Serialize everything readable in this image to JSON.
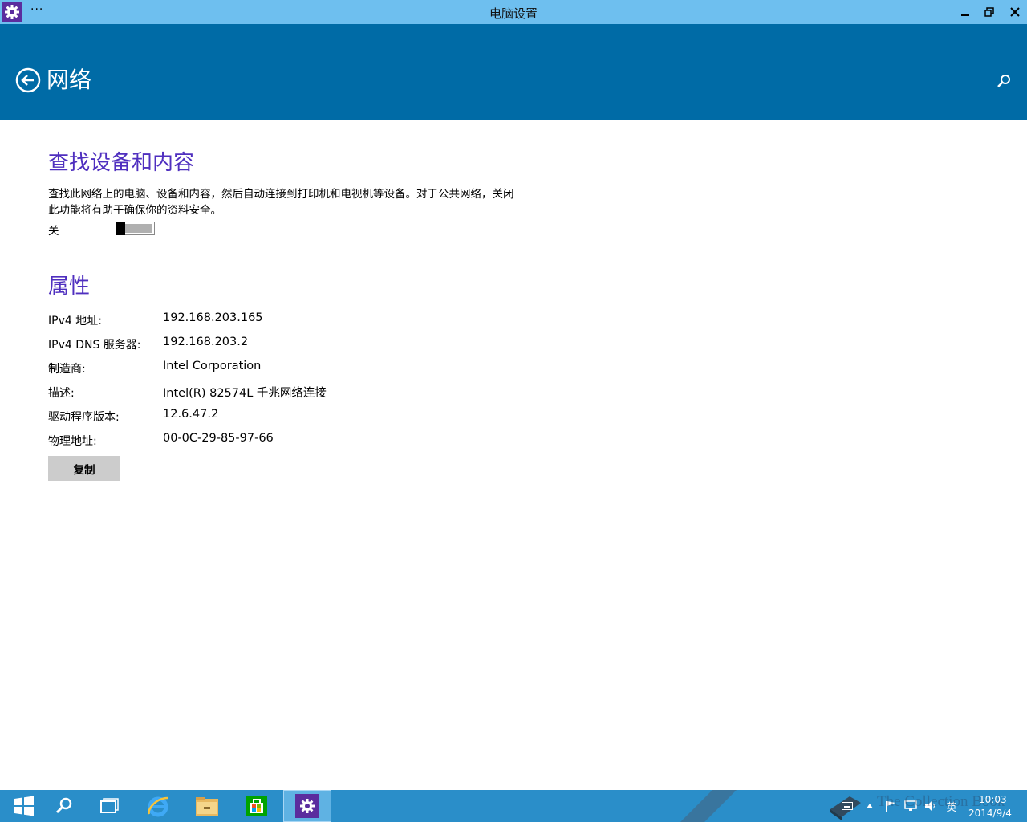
{
  "window": {
    "title": "电脑设置",
    "menu_dots": "···"
  },
  "header": {
    "title": "网络"
  },
  "find_devices": {
    "title": "查找设备和内容",
    "description": "查找此网络上的电脑、设备和内容，然后自动连接到打印机和电视机等设备。对于公共网络，关闭此功能将有助于确保你的资料安全。",
    "toggle_state": "关"
  },
  "properties": {
    "title": "属性",
    "rows": [
      {
        "label": "IPv4 地址:",
        "value": "192.168.203.165"
      },
      {
        "label": "IPv4 DNS 服务器:",
        "value": "192.168.203.2"
      },
      {
        "label": "制造商:",
        "value": "Intel Corporation"
      },
      {
        "label": "描述:",
        "value": "Intel(R) 82574L 千兆网络连接"
      },
      {
        "label": "驱动程序版本:",
        "value": "12.6.47.2"
      },
      {
        "label": "物理地址:",
        "value": "00-0C-29-85-97-66"
      }
    ],
    "copy_label": "复制"
  },
  "taskbar": {
    "items": [
      "windows-start",
      "search",
      "task-view",
      "internet-explorer",
      "file-explorer",
      "store",
      "settings"
    ],
    "ime": "英",
    "time": "10:03",
    "date": "2014/9/4",
    "watermark": "The Collection Book"
  }
}
